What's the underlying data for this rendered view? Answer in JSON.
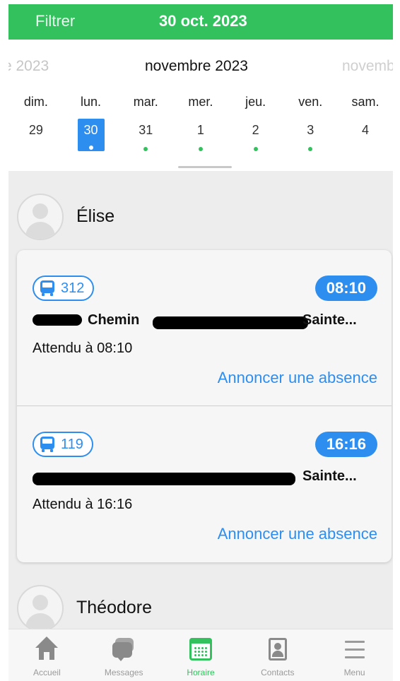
{
  "header": {
    "filter_label": "Filtrer",
    "current_date": "30 oct. 2023"
  },
  "calendar": {
    "prev_month": "re 2023",
    "current_month": "novembre 2023",
    "next_month": "novemb",
    "days": [
      "dim.",
      "lun.",
      "mar.",
      "mer.",
      "jeu.",
      "ven.",
      "sam."
    ],
    "dates": [
      {
        "num": "29",
        "selected": false,
        "dot": false
      },
      {
        "num": "30",
        "selected": true,
        "dot": true
      },
      {
        "num": "31",
        "selected": false,
        "dot": true
      },
      {
        "num": "1",
        "selected": false,
        "dot": true
      },
      {
        "num": "2",
        "selected": false,
        "dot": true
      },
      {
        "num": "3",
        "selected": false,
        "dot": true
      },
      {
        "num": "4",
        "selected": false,
        "dot": false
      }
    ]
  },
  "children": [
    {
      "name": "Élise",
      "trips": [
        {
          "bus": "312",
          "time": "08:10",
          "address_end": "Sainte...",
          "address_start": "Chemin ",
          "expected": "Attendu à 08:10",
          "action": "Annoncer une absence"
        },
        {
          "bus": "119",
          "time": "16:16",
          "address_end": "Sainte...",
          "address_start": "",
          "expected": "Attendu à 16:16",
          "action": "Annoncer une absence"
        }
      ]
    },
    {
      "name": "Théodore"
    }
  ],
  "tabbar": {
    "items": [
      {
        "label": "Accueil",
        "icon": "home-icon"
      },
      {
        "label": "Messages",
        "icon": "messages-icon"
      },
      {
        "label": "Horaire",
        "icon": "calendar-icon",
        "active": true
      },
      {
        "label": "Contacts",
        "icon": "contacts-icon"
      },
      {
        "label": "Menu",
        "icon": "menu-icon"
      }
    ]
  },
  "colors": {
    "brand_green": "#33c15e",
    "accent_blue": "#2d8ef0"
  }
}
